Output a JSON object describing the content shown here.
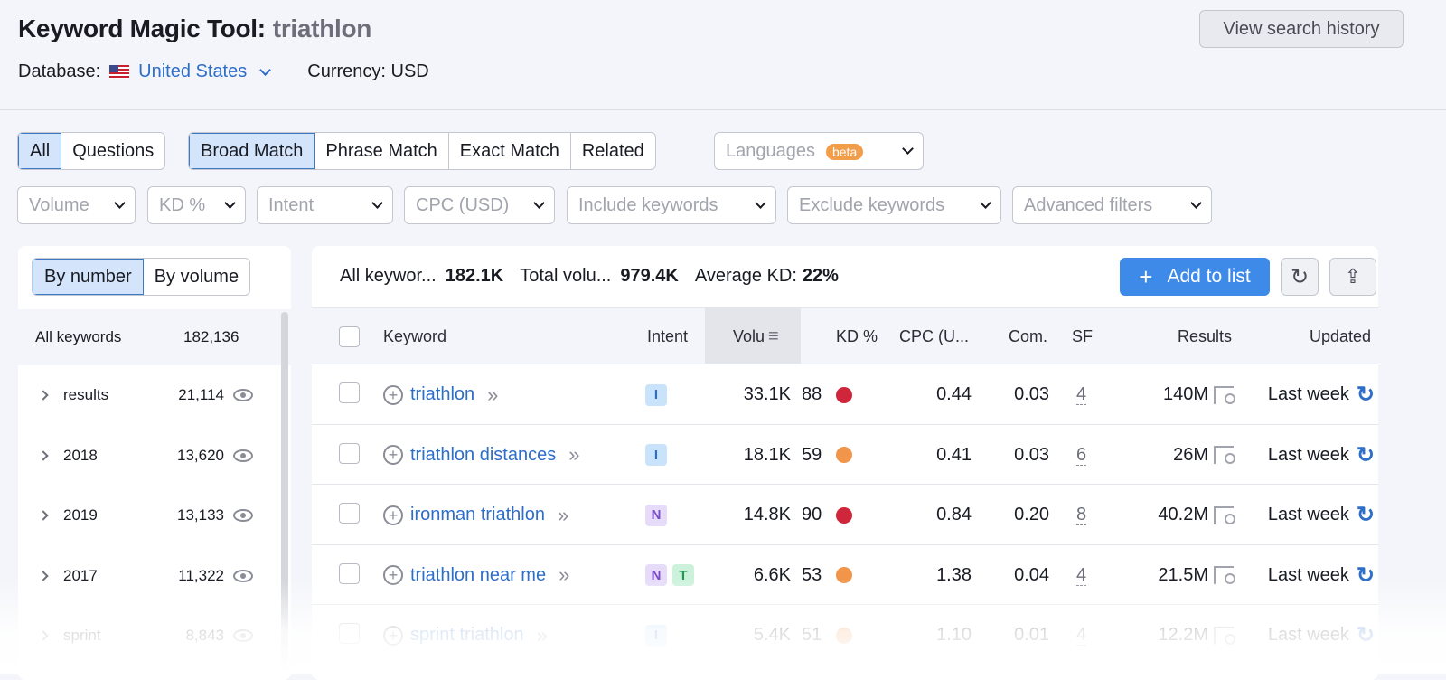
{
  "header": {
    "title": "Keyword Magic Tool:",
    "query": "triathlon",
    "database_label": "Database:",
    "database_value": "United States",
    "currency": "Currency: USD",
    "history_button": "View search history"
  },
  "tabs_type": [
    {
      "label": "All",
      "active": true
    },
    {
      "label": "Questions",
      "active": false
    }
  ],
  "tabs_match": [
    {
      "label": "Broad Match",
      "active": true
    },
    {
      "label": "Phrase Match",
      "active": false
    },
    {
      "label": "Exact Match",
      "active": false
    },
    {
      "label": "Related",
      "active": false
    }
  ],
  "languages": {
    "label": "Languages",
    "badge": "beta"
  },
  "filters": [
    "Volume",
    "KD %",
    "Intent",
    "CPC (USD)",
    "Include keywords",
    "Exclude keywords",
    "Advanced filters"
  ],
  "left": {
    "toggle": [
      "By number",
      "By volume"
    ],
    "all_label": "All keywords",
    "all_count": "182,136",
    "groups": [
      {
        "name": "results",
        "count": "21,114"
      },
      {
        "name": "2018",
        "count": "13,620"
      },
      {
        "name": "2019",
        "count": "13,133"
      },
      {
        "name": "2017",
        "count": "11,322"
      },
      {
        "name": "sprint",
        "count": "8,843"
      }
    ]
  },
  "summary": {
    "all_label": "All keywor...",
    "all_value": "182.1K",
    "total_label": "Total volu...",
    "total_value": "979.4K",
    "kd_label": "Average KD:",
    "kd_value": "22%",
    "add_button": "Add to list"
  },
  "columns": [
    "Keyword",
    "Intent",
    "Volu",
    "KD %",
    "CPC (U...",
    "Com.",
    "SF",
    "Results",
    "Updated"
  ],
  "rows": [
    {
      "keyword": "triathlon",
      "intent": [
        "I"
      ],
      "volume": "33.1K",
      "kd": "88",
      "kd_color": "#d0263b",
      "cpc": "0.44",
      "com": "0.03",
      "sf": "4",
      "results": "140M",
      "updated": "Last week"
    },
    {
      "keyword": "triathlon distances",
      "intent": [
        "I"
      ],
      "volume": "18.1K",
      "kd": "59",
      "kd_color": "#f0954a",
      "cpc": "0.41",
      "com": "0.03",
      "sf": "6",
      "results": "26M",
      "updated": "Last week"
    },
    {
      "keyword": "ironman triathlon",
      "intent": [
        "N"
      ],
      "volume": "14.8K",
      "kd": "90",
      "kd_color": "#d0263b",
      "cpc": "0.84",
      "com": "0.20",
      "sf": "8",
      "results": "40.2M",
      "updated": "Last week"
    },
    {
      "keyword": "triathlon near me",
      "intent": [
        "N",
        "T"
      ],
      "volume": "6.6K",
      "kd": "53",
      "kd_color": "#f0954a",
      "cpc": "1.38",
      "com": "0.04",
      "sf": "4",
      "results": "21.5M",
      "updated": "Last week"
    },
    {
      "keyword": "sprint triathlon",
      "intent": [
        "I"
      ],
      "volume": "5.4K",
      "kd": "51",
      "kd_color": "#f0954a",
      "cpc": "1.10",
      "com": "0.01",
      "sf": "4",
      "results": "12.2M",
      "updated": "Last week"
    }
  ]
}
